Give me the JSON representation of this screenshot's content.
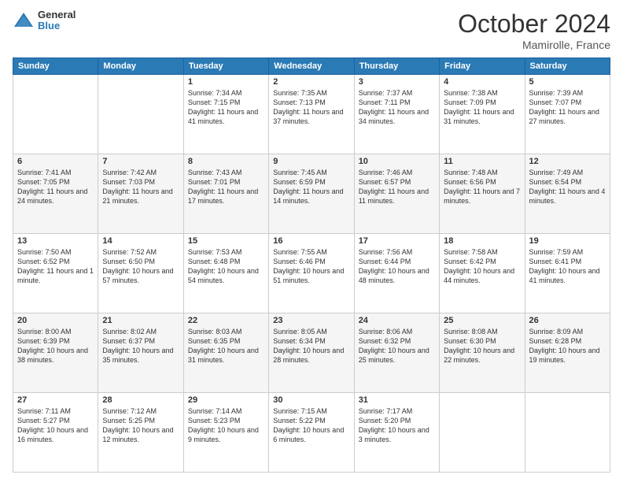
{
  "header": {
    "logo_general": "General",
    "logo_blue": "Blue",
    "month": "October 2024",
    "location": "Mamirolle, France"
  },
  "days_of_week": [
    "Sunday",
    "Monday",
    "Tuesday",
    "Wednesday",
    "Thursday",
    "Friday",
    "Saturday"
  ],
  "weeks": [
    [
      {
        "day": "",
        "sunrise": "",
        "sunset": "",
        "daylight": ""
      },
      {
        "day": "",
        "sunrise": "",
        "sunset": "",
        "daylight": ""
      },
      {
        "day": "1",
        "sunrise": "Sunrise: 7:34 AM",
        "sunset": "Sunset: 7:15 PM",
        "daylight": "Daylight: 11 hours and 41 minutes."
      },
      {
        "day": "2",
        "sunrise": "Sunrise: 7:35 AM",
        "sunset": "Sunset: 7:13 PM",
        "daylight": "Daylight: 11 hours and 37 minutes."
      },
      {
        "day": "3",
        "sunrise": "Sunrise: 7:37 AM",
        "sunset": "Sunset: 7:11 PM",
        "daylight": "Daylight: 11 hours and 34 minutes."
      },
      {
        "day": "4",
        "sunrise": "Sunrise: 7:38 AM",
        "sunset": "Sunset: 7:09 PM",
        "daylight": "Daylight: 11 hours and 31 minutes."
      },
      {
        "day": "5",
        "sunrise": "Sunrise: 7:39 AM",
        "sunset": "Sunset: 7:07 PM",
        "daylight": "Daylight: 11 hours and 27 minutes."
      }
    ],
    [
      {
        "day": "6",
        "sunrise": "Sunrise: 7:41 AM",
        "sunset": "Sunset: 7:05 PM",
        "daylight": "Daylight: 11 hours and 24 minutes."
      },
      {
        "day": "7",
        "sunrise": "Sunrise: 7:42 AM",
        "sunset": "Sunset: 7:03 PM",
        "daylight": "Daylight: 11 hours and 21 minutes."
      },
      {
        "day": "8",
        "sunrise": "Sunrise: 7:43 AM",
        "sunset": "Sunset: 7:01 PM",
        "daylight": "Daylight: 11 hours and 17 minutes."
      },
      {
        "day": "9",
        "sunrise": "Sunrise: 7:45 AM",
        "sunset": "Sunset: 6:59 PM",
        "daylight": "Daylight: 11 hours and 14 minutes."
      },
      {
        "day": "10",
        "sunrise": "Sunrise: 7:46 AM",
        "sunset": "Sunset: 6:57 PM",
        "daylight": "Daylight: 11 hours and 11 minutes."
      },
      {
        "day": "11",
        "sunrise": "Sunrise: 7:48 AM",
        "sunset": "Sunset: 6:56 PM",
        "daylight": "Daylight: 11 hours and 7 minutes."
      },
      {
        "day": "12",
        "sunrise": "Sunrise: 7:49 AM",
        "sunset": "Sunset: 6:54 PM",
        "daylight": "Daylight: 11 hours and 4 minutes."
      }
    ],
    [
      {
        "day": "13",
        "sunrise": "Sunrise: 7:50 AM",
        "sunset": "Sunset: 6:52 PM",
        "daylight": "Daylight: 11 hours and 1 minute."
      },
      {
        "day": "14",
        "sunrise": "Sunrise: 7:52 AM",
        "sunset": "Sunset: 6:50 PM",
        "daylight": "Daylight: 10 hours and 57 minutes."
      },
      {
        "day": "15",
        "sunrise": "Sunrise: 7:53 AM",
        "sunset": "Sunset: 6:48 PM",
        "daylight": "Daylight: 10 hours and 54 minutes."
      },
      {
        "day": "16",
        "sunrise": "Sunrise: 7:55 AM",
        "sunset": "Sunset: 6:46 PM",
        "daylight": "Daylight: 10 hours and 51 minutes."
      },
      {
        "day": "17",
        "sunrise": "Sunrise: 7:56 AM",
        "sunset": "Sunset: 6:44 PM",
        "daylight": "Daylight: 10 hours and 48 minutes."
      },
      {
        "day": "18",
        "sunrise": "Sunrise: 7:58 AM",
        "sunset": "Sunset: 6:42 PM",
        "daylight": "Daylight: 10 hours and 44 minutes."
      },
      {
        "day": "19",
        "sunrise": "Sunrise: 7:59 AM",
        "sunset": "Sunset: 6:41 PM",
        "daylight": "Daylight: 10 hours and 41 minutes."
      }
    ],
    [
      {
        "day": "20",
        "sunrise": "Sunrise: 8:00 AM",
        "sunset": "Sunset: 6:39 PM",
        "daylight": "Daylight: 10 hours and 38 minutes."
      },
      {
        "day": "21",
        "sunrise": "Sunrise: 8:02 AM",
        "sunset": "Sunset: 6:37 PM",
        "daylight": "Daylight: 10 hours and 35 minutes."
      },
      {
        "day": "22",
        "sunrise": "Sunrise: 8:03 AM",
        "sunset": "Sunset: 6:35 PM",
        "daylight": "Daylight: 10 hours and 31 minutes."
      },
      {
        "day": "23",
        "sunrise": "Sunrise: 8:05 AM",
        "sunset": "Sunset: 6:34 PM",
        "daylight": "Daylight: 10 hours and 28 minutes."
      },
      {
        "day": "24",
        "sunrise": "Sunrise: 8:06 AM",
        "sunset": "Sunset: 6:32 PM",
        "daylight": "Daylight: 10 hours and 25 minutes."
      },
      {
        "day": "25",
        "sunrise": "Sunrise: 8:08 AM",
        "sunset": "Sunset: 6:30 PM",
        "daylight": "Daylight: 10 hours and 22 minutes."
      },
      {
        "day": "26",
        "sunrise": "Sunrise: 8:09 AM",
        "sunset": "Sunset: 6:28 PM",
        "daylight": "Daylight: 10 hours and 19 minutes."
      }
    ],
    [
      {
        "day": "27",
        "sunrise": "Sunrise: 7:11 AM",
        "sunset": "Sunset: 5:27 PM",
        "daylight": "Daylight: 10 hours and 16 minutes."
      },
      {
        "day": "28",
        "sunrise": "Sunrise: 7:12 AM",
        "sunset": "Sunset: 5:25 PM",
        "daylight": "Daylight: 10 hours and 12 minutes."
      },
      {
        "day": "29",
        "sunrise": "Sunrise: 7:14 AM",
        "sunset": "Sunset: 5:23 PM",
        "daylight": "Daylight: 10 hours and 9 minutes."
      },
      {
        "day": "30",
        "sunrise": "Sunrise: 7:15 AM",
        "sunset": "Sunset: 5:22 PM",
        "daylight": "Daylight: 10 hours and 6 minutes."
      },
      {
        "day": "31",
        "sunrise": "Sunrise: 7:17 AM",
        "sunset": "Sunset: 5:20 PM",
        "daylight": "Daylight: 10 hours and 3 minutes."
      },
      {
        "day": "",
        "sunrise": "",
        "sunset": "",
        "daylight": ""
      },
      {
        "day": "",
        "sunrise": "",
        "sunset": "",
        "daylight": ""
      }
    ]
  ]
}
